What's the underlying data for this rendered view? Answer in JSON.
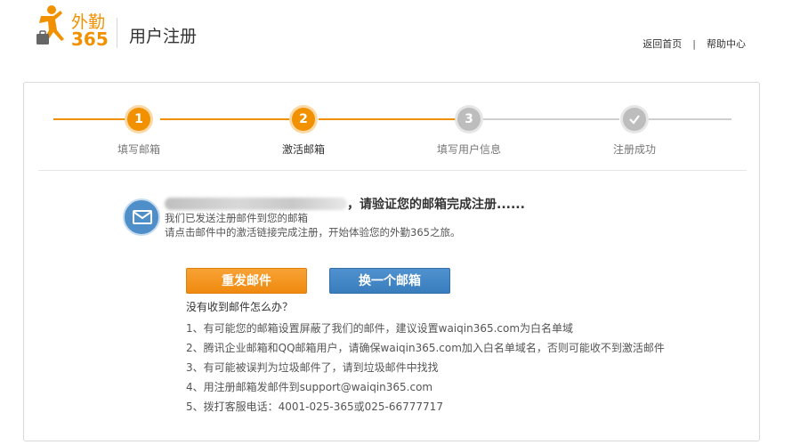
{
  "header": {
    "logo_top": "外勤",
    "logo_num": "365",
    "title": "用户注册",
    "links": [
      "返回首页",
      "帮助中心"
    ],
    "separator": "|"
  },
  "steps": [
    {
      "num": "1",
      "label": "填写邮箱",
      "state": "done"
    },
    {
      "num": "2",
      "label": "激活邮箱",
      "state": "current"
    },
    {
      "num": "3",
      "label": "填写用户信息",
      "state": "todo"
    },
    {
      "num": "",
      "label": "注册成功",
      "state": "todo"
    }
  ],
  "notice": {
    "title_suffix": "，请验证您的邮箱完成注册......",
    "line1": "我们已发送注册邮件到您的邮箱",
    "line2": "请点击邮件中的激活链接完成注册，开始体验您的外勤365之旅。"
  },
  "buttons": {
    "resend": "重发邮件",
    "change": "换一个邮箱"
  },
  "help": {
    "title": "没有收到邮件怎么办？",
    "items": [
      "1、有可能您的邮箱设置屏蔽了我们的邮件，建议设置waiqin365.com为白名单域",
      "2、腾讯企业邮箱和QQ邮箱用户，请确保waiqin365.com加入白名单域名，否则可能收不到激活邮件",
      "3、有可能被误判为垃圾邮件了，请到垃圾邮件中找找",
      "4、用注册邮箱发邮件到support@waiqin365.com",
      "5、拨打客服电话：4001-025-365或025-66777717"
    ]
  },
  "colors": {
    "accent": "#f29100",
    "blue": "#3a7dbd",
    "inactive": "#bdbdbd"
  }
}
